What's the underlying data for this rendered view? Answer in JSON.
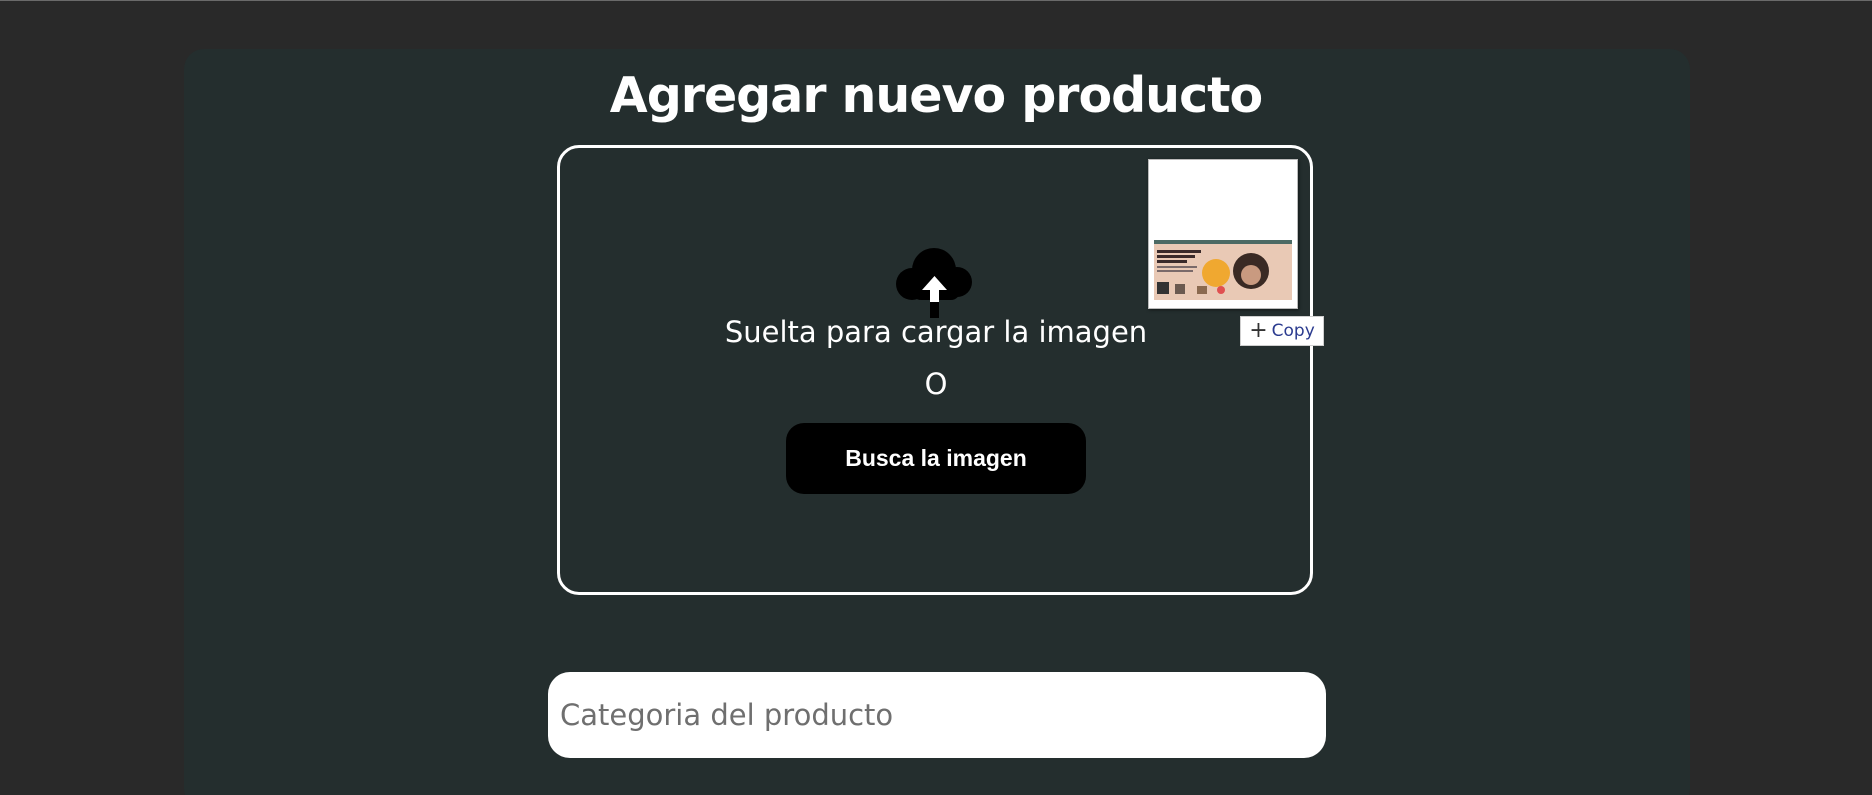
{
  "page": {
    "title": "Agregar nuevo producto"
  },
  "dropzone": {
    "icon": "cloud-upload-icon",
    "drop_text": "Suelta para cargar la imagen",
    "or_text": "O",
    "browse_label": "Busca la imagen"
  },
  "drag_preview": {
    "copy_label": "Copy",
    "plus_icon": "plus-icon"
  },
  "form": {
    "category_placeholder": "Categoria del producto",
    "category_value": ""
  },
  "colors": {
    "background": "#292929",
    "panel": "#242e2e",
    "button": "#000000",
    "text": "#ffffff"
  }
}
